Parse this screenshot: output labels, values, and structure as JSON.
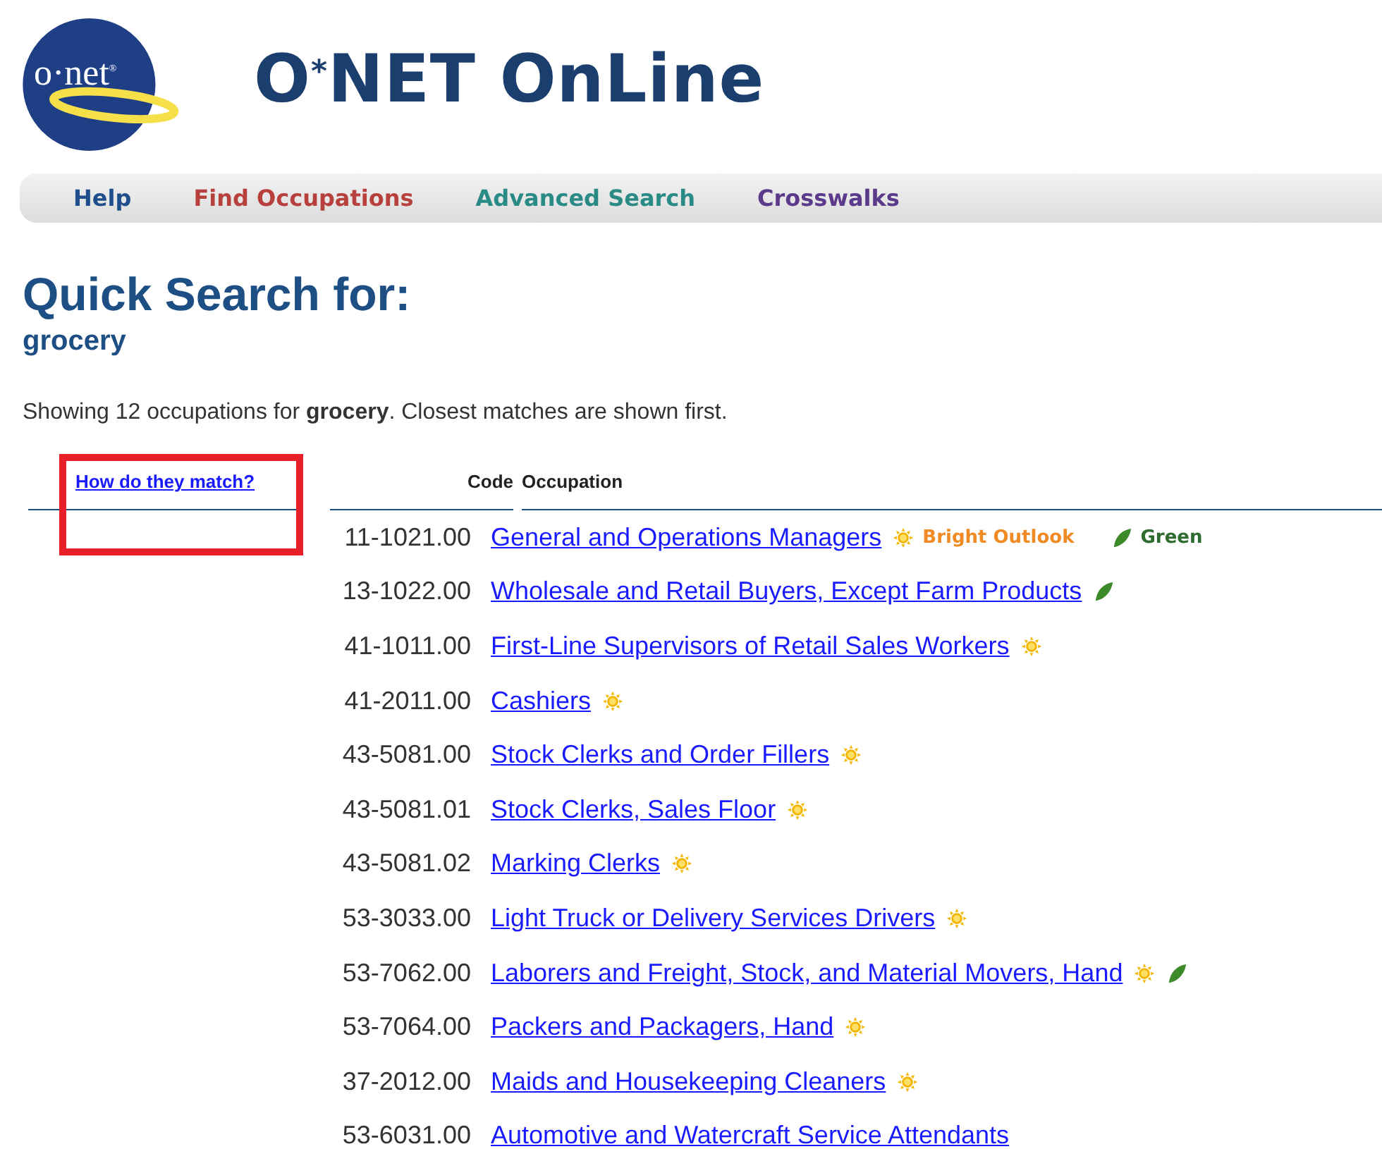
{
  "logo": {
    "text": "o·net",
    "mark": "®"
  },
  "site_title": {
    "left": "O",
    "star": "*",
    "right": "NET OnLine"
  },
  "nav": [
    {
      "label": "Help",
      "color": "#1f4e8c"
    },
    {
      "label": "Find Occupations",
      "color": "#b8403c"
    },
    {
      "label": "Advanced Search",
      "color": "#2a8a86"
    },
    {
      "label": "Crosswalks",
      "color": "#5b3a8c"
    }
  ],
  "heading": "Quick Search for:",
  "query": "grocery",
  "summary": "Showing 12 occupations for **grocery**. Closest matches are shown first.",
  "table": {
    "match_link": {
      "label": "How do they match?",
      "highlighted": true
    },
    "columns": [
      "Code",
      "Occupation"
    ],
    "rows": [
      {
        "code": "11-1021.00",
        "occupation": "General and Operations Managers",
        "tags": [
          {
            "kind": "bright",
            "label": "Bright Outlook"
          },
          {
            "kind": "green",
            "label": "Green"
          }
        ]
      },
      {
        "code": "13-1022.00",
        "occupation": "Wholesale and Retail Buyers, Except Farm Products",
        "tags": [
          {
            "kind": "green"
          }
        ]
      },
      {
        "code": "41-1011.00",
        "occupation": "First-Line Supervisors of Retail Sales Workers",
        "tags": [
          {
            "kind": "bright"
          }
        ]
      },
      {
        "code": "41-2011.00",
        "occupation": "Cashiers",
        "tags": [
          {
            "kind": "bright"
          }
        ]
      },
      {
        "code": "43-5081.00",
        "occupation": "Stock Clerks and Order Fillers",
        "tags": [
          {
            "kind": "bright"
          }
        ]
      },
      {
        "code": "43-5081.01",
        "occupation": "Stock Clerks, Sales Floor",
        "tags": [
          {
            "kind": "bright"
          }
        ]
      },
      {
        "code": "43-5081.02",
        "occupation": "Marking Clerks",
        "tags": [
          {
            "kind": "bright"
          }
        ]
      },
      {
        "code": "53-3033.00",
        "occupation": "Light Truck or Delivery Services Drivers",
        "tags": [
          {
            "kind": "bright"
          }
        ]
      },
      {
        "code": "53-7062.00",
        "occupation": "Laborers and Freight, Stock, and Material Movers, Hand",
        "tags": [
          {
            "kind": "bright"
          },
          {
            "kind": "green"
          }
        ]
      },
      {
        "code": "53-7064.00",
        "occupation": "Packers and Packagers, Hand",
        "tags": [
          {
            "kind": "bright"
          }
        ]
      },
      {
        "code": "37-2012.00",
        "occupation": "Maids and Housekeeping Cleaners",
        "tags": [
          {
            "kind": "bright"
          }
        ]
      },
      {
        "code": "53-6031.00",
        "occupation": "Automotive and Watercraft Service Attendants",
        "tags": []
      }
    ]
  }
}
